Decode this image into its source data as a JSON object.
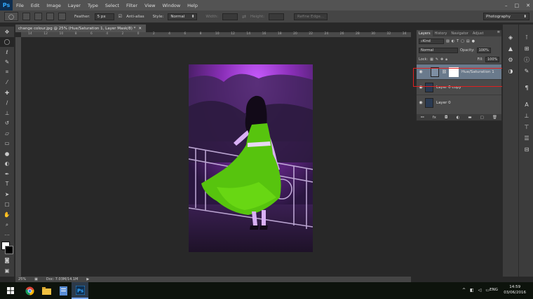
{
  "app": {
    "logo": "Ps"
  },
  "menu": [
    "File",
    "Edit",
    "Image",
    "Layer",
    "Type",
    "Select",
    "Filter",
    "View",
    "Window",
    "Help"
  ],
  "window_controls": {
    "minimize": "–",
    "maximize": "□",
    "close": "✕"
  },
  "options": {
    "feather_label": "Feather:",
    "feather_value": "5 px",
    "antialias_label": "Anti-alias",
    "style_label": "Style:",
    "style_value": "Normal",
    "width_label": "Width:",
    "height_label": "Height:",
    "refine_edge": "Refine Edge...",
    "workspace": "Photography"
  },
  "document": {
    "tab_title": "change colour.jpg @ 25% (Hue/Saturation 1, Layer Mask/8) *",
    "ruler_ticks": [
      "14",
      "12",
      "10",
      "8",
      "6",
      "4",
      "2",
      "0",
      "2",
      "4",
      "6",
      "8",
      "10",
      "12",
      "14",
      "16",
      "18",
      "20",
      "22",
      "24",
      "26",
      "28",
      "30",
      "32",
      "34"
    ],
    "zoom": "25%",
    "doc_info": "Doc: 7.03M/14.1M"
  },
  "layers_panel": {
    "tabs": [
      "Layers",
      "History",
      "Navigator",
      "Adjust"
    ],
    "kind": "Kind",
    "blend_mode": "Normal",
    "opacity_label": "Opacity:",
    "opacity_value": "100%",
    "lock_label": "Lock:",
    "fill_label": "Fill:",
    "fill_value": "100%",
    "layers": [
      {
        "name": "Hue/Saturation 1",
        "selected": true
      },
      {
        "name": "Layer 0 copy",
        "selected": false
      },
      {
        "name": "Layer 0",
        "selected": false
      }
    ],
    "footer_icons": [
      "link-icon",
      "fx-icon",
      "mask-icon",
      "adjustment-icon",
      "folder-icon",
      "new-layer-icon",
      "trash-icon"
    ]
  },
  "taskbar": {
    "language": "ENG",
    "time": "14:59",
    "date": "03/06/2016"
  },
  "colors": {
    "accent_highlight": "#e0201f",
    "photo_purple": "#9b2fc9",
    "dress_green": "#58c70d",
    "selected_layer": "#6a7a8c"
  }
}
